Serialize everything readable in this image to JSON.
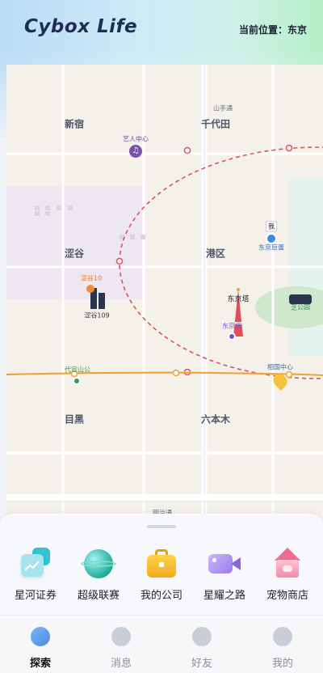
{
  "header": {
    "app_title": "Cybox Life",
    "location_text": "当前位置：东京"
  },
  "map": {
    "districts": [
      {
        "name": "新宿"
      },
      {
        "name": "千代田"
      },
      {
        "name": "涩谷"
      },
      {
        "name": "港区"
      },
      {
        "name": "目黑"
      },
      {
        "name": "六本木"
      }
    ],
    "small_labels": {
      "yamate": "山手通",
      "poi_music": "艺人中心",
      "poi_shibuya10": "涩谷10",
      "poi_shibuya109": "涩谷109",
      "poi_tokyotower": "东京塔",
      "poi_tower_tag": "东京塔",
      "poi_zhiyuan": "芝公园",
      "poi_daibutsu": "代官山公",
      "poi_xiangguo": "相国中心",
      "poi_tokyo_dome": "东京巨蛋",
      "poi_bottom_road": "明治通",
      "poi_jvbadge": "我"
    },
    "colors": {
      "route_circle": "#e0505a",
      "rail_line": "#f0a030",
      "park": "#c8e6c9"
    }
  },
  "features": [
    {
      "label": "星河证券",
      "icon": "stock-chart-icon"
    },
    {
      "label": "超级联赛",
      "icon": "globe-league-icon"
    },
    {
      "label": "我的公司",
      "icon": "briefcase-icon"
    },
    {
      "label": "星耀之路",
      "icon": "video-camera-icon"
    },
    {
      "label": "宠物商店",
      "icon": "pet-house-icon"
    }
  ],
  "tabs": [
    {
      "label": "探索",
      "icon": "explore-icon",
      "active": true
    },
    {
      "label": "消息",
      "icon": "message-icon",
      "active": false
    },
    {
      "label": "好友",
      "icon": "friends-icon",
      "active": false
    },
    {
      "label": "我的",
      "icon": "profile-icon",
      "active": false
    }
  ]
}
